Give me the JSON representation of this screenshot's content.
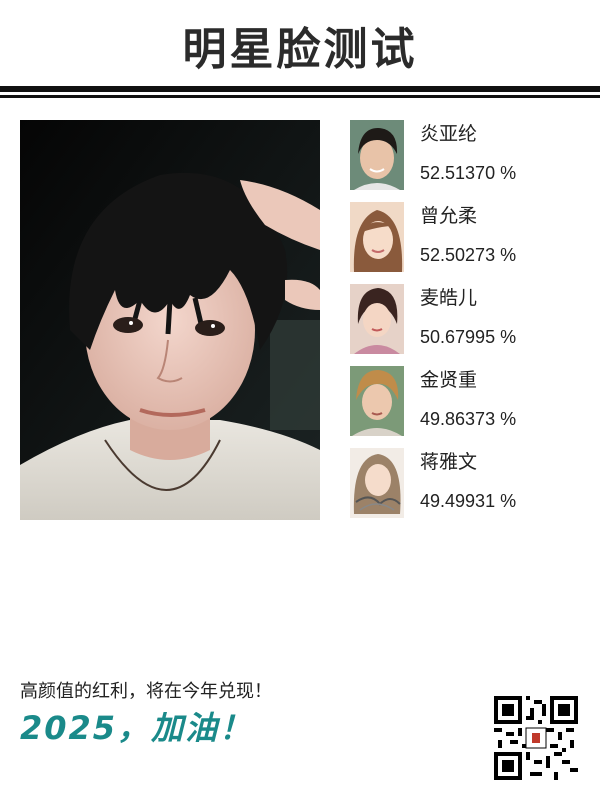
{
  "title": "明星脸测试",
  "matches": [
    {
      "name": "炎亚纶",
      "score": "52.51370 %"
    },
    {
      "name": "曾允柔",
      "score": "52.50273 %"
    },
    {
      "name": "麦皓儿",
      "score": "50.67995 %"
    },
    {
      "name": "金贤重",
      "score": "49.86373 %"
    },
    {
      "name": "蒋雅文",
      "score": "49.49931 %"
    }
  ],
  "footer": {
    "line1": "高颜值的红利，将在今年兑现！",
    "slogan": "2025，加油！"
  },
  "colors": {
    "accent": "#1a8a8a",
    "title": "#2b2b2b",
    "rule": "#111111"
  }
}
